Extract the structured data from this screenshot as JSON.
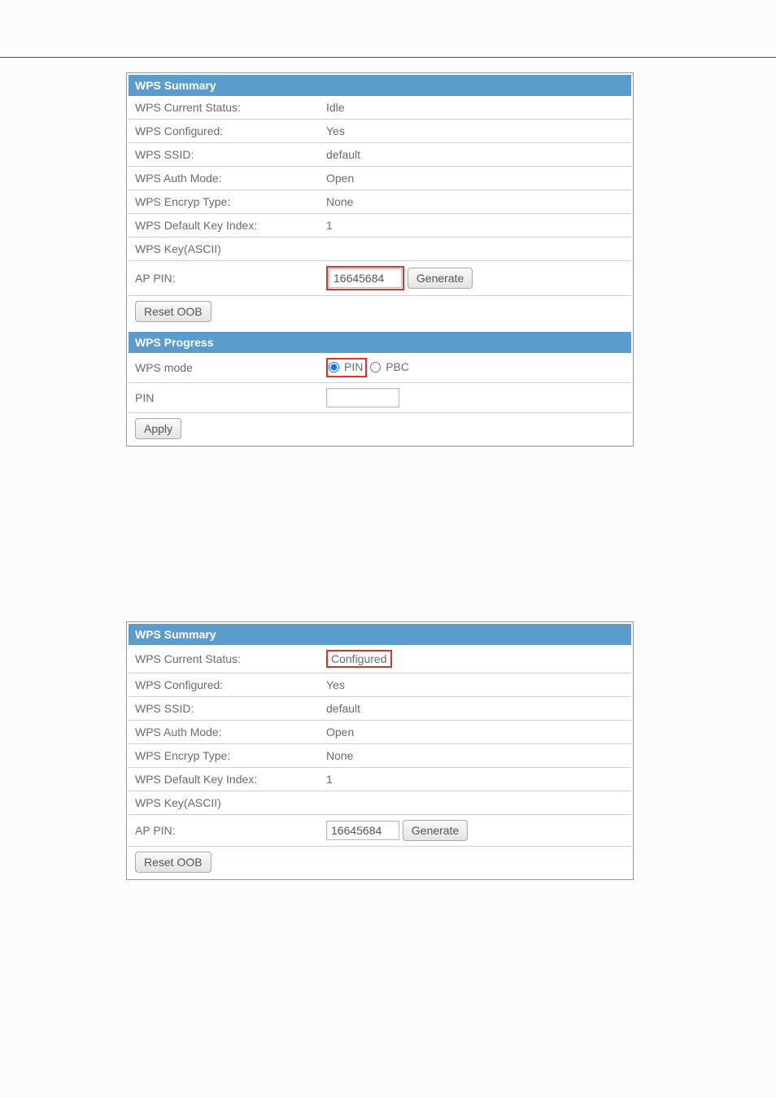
{
  "panel1": {
    "summary": {
      "header": "WPS Summary",
      "rows": {
        "status_label": "WPS Current Status:",
        "status_value": "Idle",
        "configured_label": "WPS Configured:",
        "configured_value": "Yes",
        "ssid_label": "WPS SSID:",
        "ssid_value": "default",
        "auth_label": "WPS Auth Mode:",
        "auth_value": "Open",
        "encryp_label": "WPS Encryp Type:",
        "encryp_value": "None",
        "keyidx_label": "WPS Default Key Index:",
        "keyidx_value": "1",
        "keyascii_label": "WPS Key(ASCII)",
        "keyascii_value": "",
        "appin_label": "AP PIN:",
        "appin_value": "16645684",
        "generate_label": "Generate",
        "reset_label": "Reset OOB"
      }
    },
    "progress": {
      "header": "WPS Progress",
      "mode_label": "WPS mode",
      "radio_pin": "PIN",
      "radio_pbc": "PBC",
      "pin_label": "PIN",
      "pin_value": "",
      "apply_label": "Apply"
    }
  },
  "panel2": {
    "summary": {
      "header": "WPS Summary",
      "rows": {
        "status_label": "WPS Current Status:",
        "status_value": "Configured",
        "configured_label": "WPS Configured:",
        "configured_value": "Yes",
        "ssid_label": "WPS SSID:",
        "ssid_value": "default",
        "auth_label": "WPS Auth Mode:",
        "auth_value": "Open",
        "encryp_label": "WPS Encryp Type:",
        "encryp_value": "None",
        "keyidx_label": "WPS Default Key Index:",
        "keyidx_value": "1",
        "keyascii_label": "WPS Key(ASCII)",
        "keyascii_value": "",
        "appin_label": "AP PIN:",
        "appin_value": "16645684",
        "generate_label": "Generate",
        "reset_label": "Reset OOB"
      }
    }
  }
}
